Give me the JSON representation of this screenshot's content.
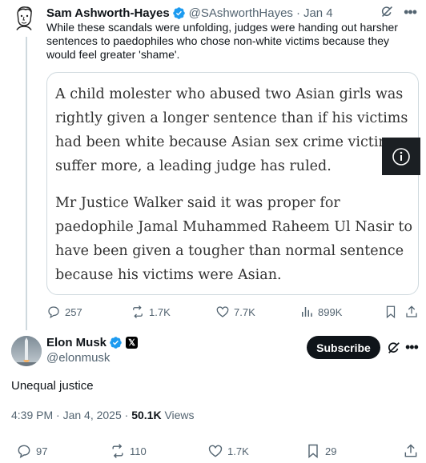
{
  "quoted_tweet": {
    "author_name": "Sam Ashworth-Hayes",
    "handle": "@SAshworthHayes",
    "separator": "·",
    "date": "Jan 4",
    "text": "While these scandals were unfolding, judges were handing out harsher sentences to paedophiles who chose non-white victims because they would feel greater 'shame'.",
    "article_paragraphs": [
      "A child molester who abused two Asian girls was rightly given a longer sentence than if his victims had been white because Asian sex crime victims suffer more, a leading judge has ruled.",
      "Mr Justice Walker said it was proper for paedophile Jamal Muhammed Raheem Ul Nasir to have been given a tougher than normal sentence because his victims were Asian."
    ],
    "stats": {
      "replies": "257",
      "reposts": "1.7K",
      "likes": "7.7K",
      "views": "899K"
    }
  },
  "main_tweet": {
    "author_name": "Elon Musk",
    "handle": "@elonmusk",
    "subscribe_label": "Subscribe",
    "x_badge": "𝕏",
    "text": "Unequal justice",
    "time": "4:39 PM · Jan 4, 2025 · ",
    "views_count": "50.1K",
    "views_label": "Views",
    "stats": {
      "replies": "97",
      "reposts": "110",
      "likes": "1.7K",
      "bookmarks": "29"
    }
  },
  "colors": {
    "verified_blue": "#1d9bf0",
    "text_secondary": "#536471",
    "border": "#cfd9de"
  }
}
